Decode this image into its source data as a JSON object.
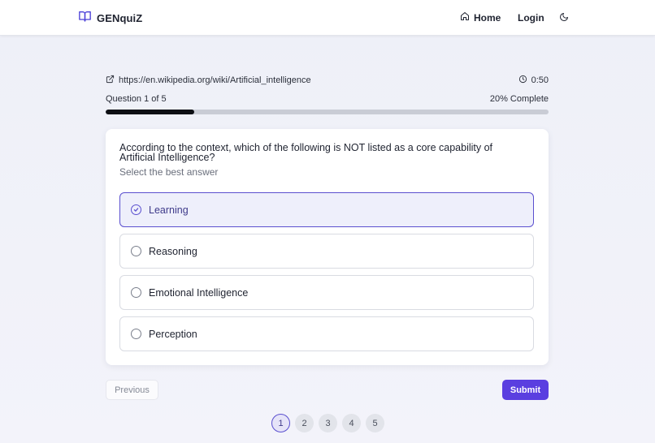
{
  "app": {
    "title": "GENquiZ"
  },
  "nav": {
    "home": "Home",
    "login": "Login"
  },
  "source": {
    "url": "https://en.wikipedia.org/wiki/Artificial_intelligence"
  },
  "timer": {
    "value": "0:50"
  },
  "progress": {
    "label": "Question 1 of 5",
    "percent_label": "20% Complete",
    "fraction": 0.2
  },
  "question": {
    "text": "According to the context, which of the following is NOT listed as a core capability of Artificial Intelligence?",
    "hint": "Select the best answer",
    "options": [
      {
        "label": "Learning",
        "selected": true
      },
      {
        "label": "Reasoning",
        "selected": false
      },
      {
        "label": "Emotional Intelligence",
        "selected": false
      },
      {
        "label": "Perception",
        "selected": false
      }
    ]
  },
  "actions": {
    "previous": "Previous",
    "submit": "Submit"
  },
  "pagination": {
    "pages": [
      "1",
      "2",
      "3",
      "4",
      "5"
    ],
    "current": "1"
  },
  "colors": {
    "accent": "#5a3fe0",
    "progress_fill": "#0d0f14",
    "selected_border": "#5a4fcf"
  },
  "icons": {
    "brand": "book-open-icon",
    "home": "home-icon",
    "theme": "moon-icon",
    "source": "external-link-icon",
    "timer": "clock-icon",
    "selected_option": "check-circle-icon"
  }
}
